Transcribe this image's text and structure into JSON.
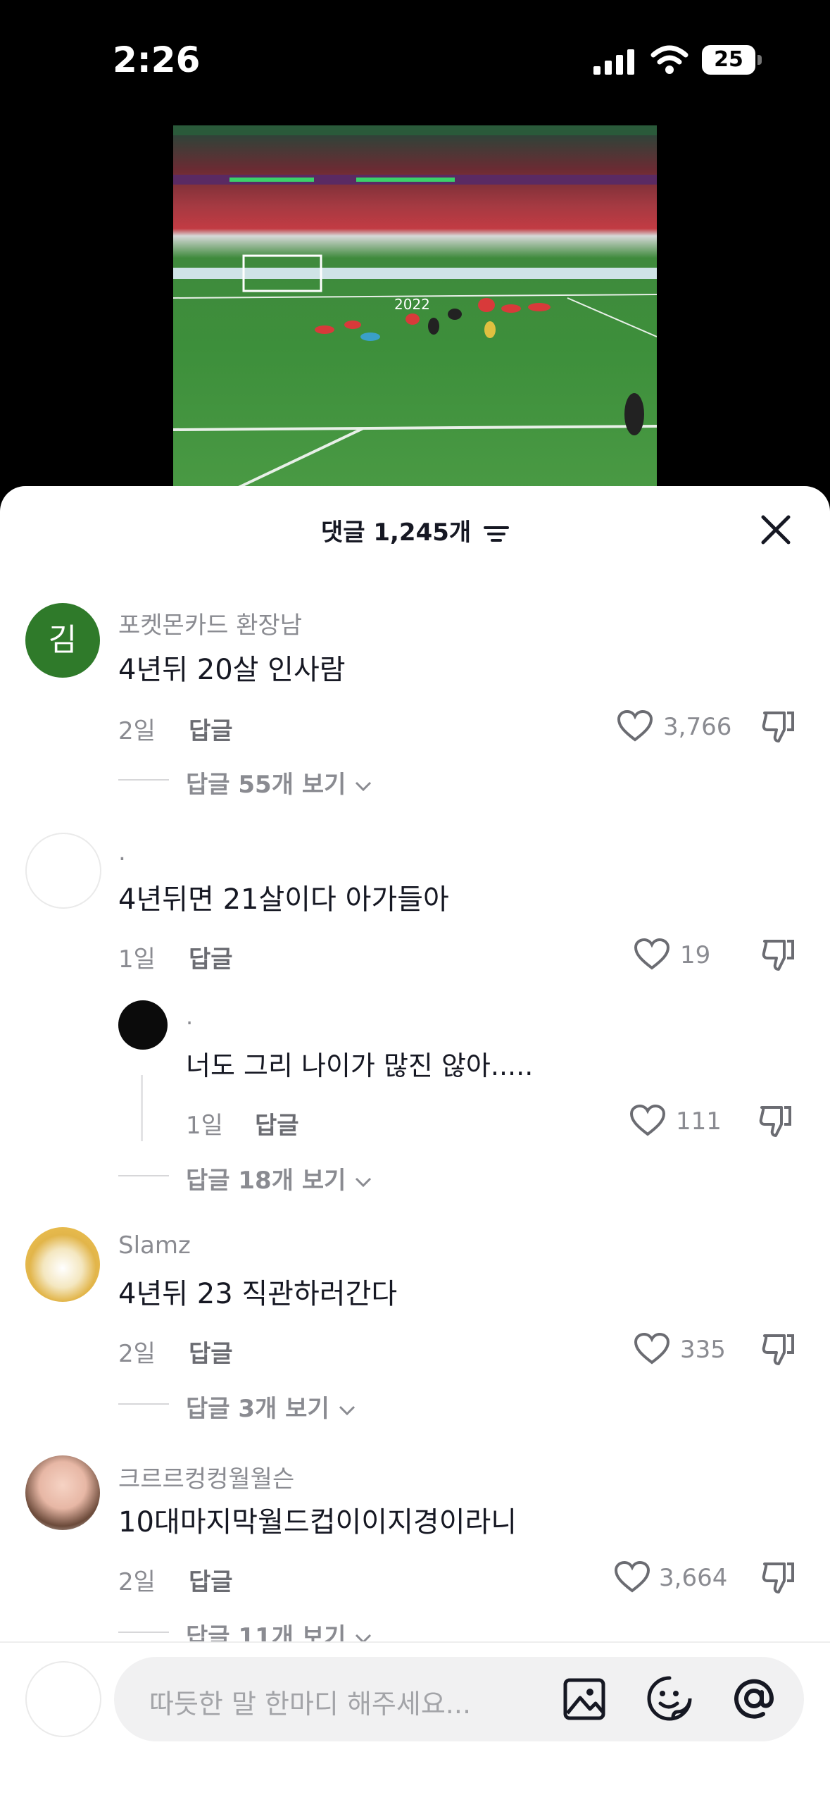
{
  "status_bar": {
    "time": "2:26",
    "battery": "25"
  },
  "video": {
    "overlay_text": "2022"
  },
  "sheet": {
    "title": "댓글 1,245개"
  },
  "comments": [
    {
      "username": "포켓몬카드 환장남",
      "avatar_initial": "김",
      "text": "4년뒤 20살 인사람",
      "time": "2일",
      "reply_label": "답글",
      "likes": "3,766",
      "view_replies": "답글 55개 보기"
    },
    {
      "username": ".",
      "text": "4년뒤면 21살이다 아가들아",
      "time": "1일",
      "reply_label": "답글",
      "likes": "19",
      "reply": {
        "username": ".",
        "text": "너도 그리 나이가 많진 않아.....",
        "time": "1일",
        "reply_label": "답글",
        "likes": "111"
      },
      "view_replies": "답글 18개 보기"
    },
    {
      "username": "Slamz",
      "text": "4년뒤 23 직관하러간다",
      "time": "2일",
      "reply_label": "답글",
      "likes": "335",
      "view_replies": "답글 3개 보기"
    },
    {
      "username": "크르르컹컹월월슨",
      "text": "10대마지막월드컵이이지경이라니",
      "time": "2일",
      "reply_label": "답글",
      "likes": "3,664",
      "view_replies": "답글 11개 보기"
    }
  ],
  "input": {
    "placeholder": "따듯한 말 한마디 해주세요..."
  }
}
